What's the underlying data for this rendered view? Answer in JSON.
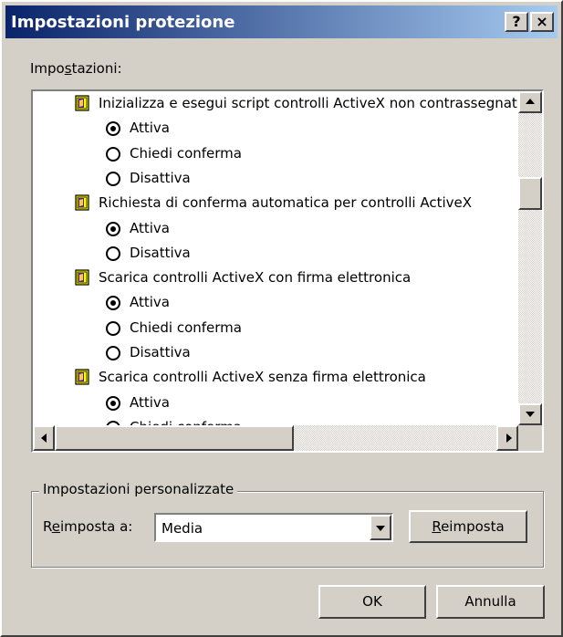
{
  "window": {
    "title": "Impostazioni protezione",
    "help_button": "?",
    "close_button": "×",
    "titlebar_colors": [
      "#0a246a",
      "#a6caf0"
    ],
    "face_color": "#d4d0c8"
  },
  "settings_label": {
    "pre": "Impo",
    "accel": "s",
    "post": "tazioni:"
  },
  "settings_list": [
    {
      "type": "setting",
      "icon": "security-setting-icon",
      "label": "Inizializza e esegui script controlli ActiveX non contrassegnati come sicuri"
    },
    {
      "type": "option",
      "label": "Attiva",
      "selected": true
    },
    {
      "type": "option",
      "label": "Chiedi conferma",
      "selected": false
    },
    {
      "type": "option",
      "label": "Disattiva",
      "selected": false
    },
    {
      "type": "setting",
      "icon": "security-setting-icon",
      "label": "Richiesta di conferma automatica per controlli ActiveX"
    },
    {
      "type": "option",
      "label": "Attiva",
      "selected": true
    },
    {
      "type": "option",
      "label": "Disattiva",
      "selected": false
    },
    {
      "type": "setting",
      "icon": "security-setting-icon",
      "label": "Scarica controlli ActiveX con firma elettronica"
    },
    {
      "type": "option",
      "label": "Attiva",
      "selected": true
    },
    {
      "type": "option",
      "label": "Chiedi conferma",
      "selected": false
    },
    {
      "type": "option",
      "label": "Disattiva",
      "selected": false
    },
    {
      "type": "setting",
      "icon": "security-setting-icon",
      "label": "Scarica controlli ActiveX senza firma elettronica"
    },
    {
      "type": "option",
      "label": "Attiva",
      "selected": true
    },
    {
      "type": "option",
      "label": "Chiedi conferma",
      "selected": false
    }
  ],
  "custom_group": {
    "title": "Impostazioni personalizzate",
    "reset_label": {
      "pre": "R",
      "accel": "e",
      "post": "imposta a:"
    },
    "reset_value": "Media",
    "reset_button": {
      "pre": "",
      "accel": "R",
      "post": "eimposta"
    }
  },
  "buttons": {
    "ok": "OK",
    "cancel": "Annulla"
  }
}
